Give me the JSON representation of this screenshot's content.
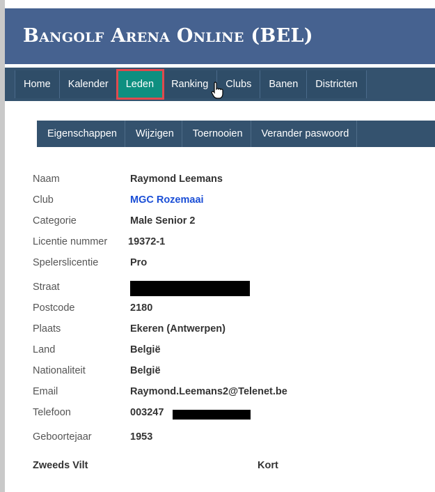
{
  "header": {
    "title": "Bangolf Arena Online (BEL)"
  },
  "nav": {
    "items": [
      {
        "label": "Home"
      },
      {
        "label": "Kalender"
      },
      {
        "label": "Leden"
      },
      {
        "label": "Ranking"
      },
      {
        "label": "Clubs"
      },
      {
        "label": "Banen"
      },
      {
        "label": "Districten"
      }
    ],
    "active": "Leden"
  },
  "subnav": {
    "items": [
      {
        "label": "Eigenschappen"
      },
      {
        "label": "Wijzigen"
      },
      {
        "label": "Toernooien"
      },
      {
        "label": "Verander paswoord"
      }
    ]
  },
  "member": {
    "naam_label": "Naam",
    "naam": "Raymond Leemans",
    "club_label": "Club",
    "club": "MGC Rozemaai",
    "categorie_label": "Categorie",
    "categorie": "Male Senior 2",
    "licentie_label": "Licentie nummer",
    "licentie": "19372-1",
    "spelerslicentie_label": "Spelerslicentie",
    "spelerslicentie": "Pro",
    "straat_label": "Straat",
    "postcode_label": "Postcode",
    "postcode": "2180",
    "plaats_label": "Plaats",
    "plaats": "Ekeren (Antwerpen)",
    "land_label": "Land",
    "land": "België",
    "nationaliteit_label": "Nationaliteit",
    "nationaliteit": "België",
    "email_label": "Email",
    "email": "Raymond.Leemans2@Telenet.be",
    "telefoon_label": "Telefoon",
    "telefoon": "003247",
    "geboortejaar_label": "Geboortejaar",
    "geboortejaar": "1953"
  },
  "footer": {
    "left": "Zweeds Vilt",
    "right": "Kort"
  },
  "colors": {
    "header": "#466290",
    "navbar": "#34526e",
    "active": "#0e8f80",
    "highlight": "#e04a4e",
    "link": "#1a4ed6"
  }
}
